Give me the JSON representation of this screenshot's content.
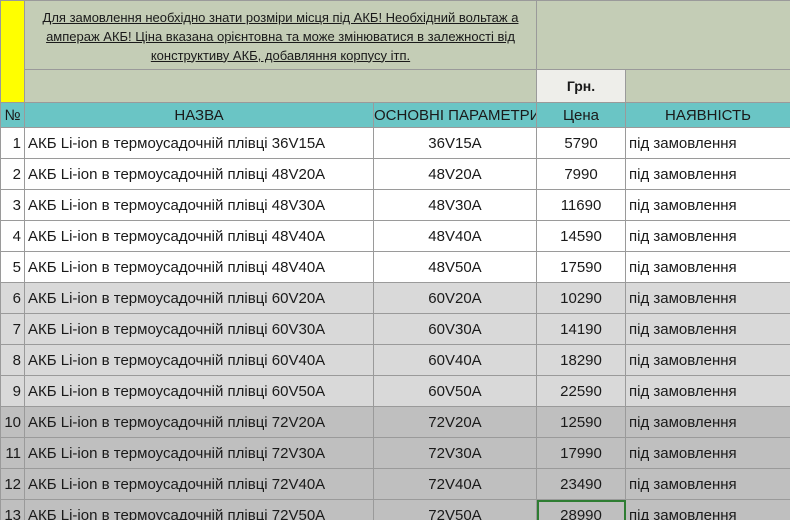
{
  "note": "Для замовлення необхідно знати розміри місця під АКБ! Необхідний вольтаж а ампераж АКБ! Ціна вказана орієнтовна та може змінюватися в залежності від конструктиву АКБ, добавляння корпусу ітп.",
  "unit_label": "Грн.",
  "headers": {
    "num": "№",
    "name": "НАЗВА",
    "params": "ОСНОВНІ ПАРАМЕТРИ",
    "price": "Цена",
    "availability": "НАЯВНІСТЬ"
  },
  "rows": [
    {
      "num": "1",
      "name": "АКБ Li-ion в термоусадочній плівці 36V15A",
      "params": "36V15A",
      "price": "5790",
      "availability": "під замовлення"
    },
    {
      "num": "2",
      "name": "АКБ Li-ion в термоусадочній плівці 48V20A",
      "params": "48V20A",
      "price": "7990",
      "availability": "під замовлення"
    },
    {
      "num": "3",
      "name": "АКБ Li-ion в термоусадочній плівці 48V30A",
      "params": "48V30A",
      "price": "11690",
      "availability": "під замовлення"
    },
    {
      "num": "4",
      "name": "АКБ Li-ion в термоусадочній плівці 48V40A",
      "params": "48V40A",
      "price": "14590",
      "availability": "під замовлення"
    },
    {
      "num": "5",
      "name": "АКБ Li-ion в термоусадочній плівці 48V40A",
      "params": "48V50A",
      "price": "17590",
      "availability": "під замовлення"
    },
    {
      "num": "6",
      "name": "АКБ Li-ion в термоусадочній плівці 60V20A",
      "params": "60V20A",
      "price": "10290",
      "availability": "під замовлення"
    },
    {
      "num": "7",
      "name": "АКБ Li-ion в термоусадочній плівці 60V30A",
      "params": "60V30A",
      "price": "14190",
      "availability": "під замовлення"
    },
    {
      "num": "8",
      "name": "АКБ Li-ion в термоусадочній плівці 60V40A",
      "params": "60V40A",
      "price": "18290",
      "availability": "під замовлення"
    },
    {
      "num": "9",
      "name": "АКБ Li-ion в термоусадочній плівці 60V50A",
      "params": "60V50A",
      "price": "22590",
      "availability": "під замовлення"
    },
    {
      "num": "10",
      "name": "АКБ Li-ion в термоусадочній плівці 72V20A",
      "params": "72V20A",
      "price": "12590",
      "availability": "під замовлення"
    },
    {
      "num": "11",
      "name": "АКБ Li-ion в термоусадочній плівці 72V30A",
      "params": "72V30A",
      "price": "17990",
      "availability": "під замовлення"
    },
    {
      "num": "12",
      "name": "АКБ Li-ion в термоусадочній плівці 72V40A",
      "params": "72V40A",
      "price": "23490",
      "availability": "під замовлення"
    },
    {
      "num": "13",
      "name": "АКБ Li-ion в термоусадочній плівці 72V50A",
      "params": "72V50A",
      "price": "28990",
      "availability": "під замовлення"
    }
  ],
  "colors": {
    "header_teal": "#6ac5c5",
    "note_bg": "#c4cdb6",
    "corner_yellow": "#ffff00",
    "group_36_48": "#ffffff",
    "group_60": "#d9d9d9",
    "group_72": "#bfbfbf",
    "selection": "#2e7d32"
  }
}
